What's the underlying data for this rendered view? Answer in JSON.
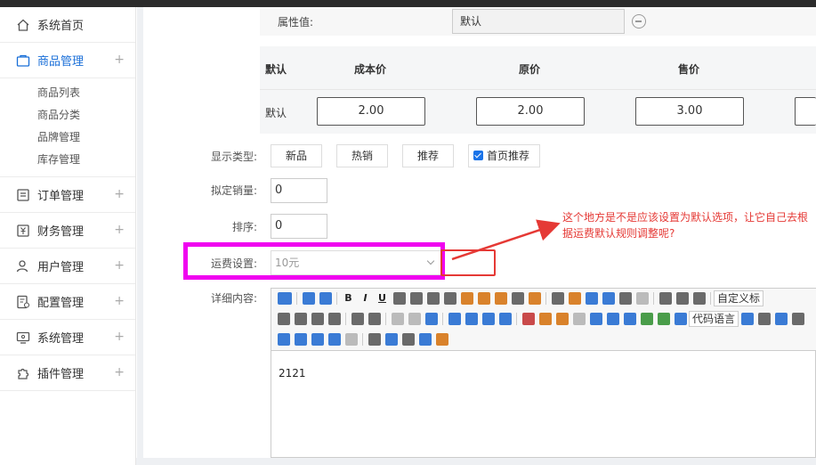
{
  "sidebar": {
    "items": [
      {
        "label": "系统首页",
        "icon": "home-icon"
      },
      {
        "label": "商品管理",
        "icon": "box-icon",
        "active": true
      },
      {
        "label": "订单管理",
        "icon": "order-icon"
      },
      {
        "label": "财务管理",
        "icon": "finance-icon"
      },
      {
        "label": "用户管理",
        "icon": "user-icon"
      },
      {
        "label": "配置管理",
        "icon": "config-icon"
      },
      {
        "label": "系统管理",
        "icon": "monitor-icon"
      },
      {
        "label": "插件管理",
        "icon": "puzzle-icon"
      }
    ],
    "expand_symbol": "+",
    "sub_items": [
      "商品列表",
      "商品分类",
      "品牌管理",
      "库存管理"
    ]
  },
  "attr": {
    "label": "属性值:",
    "value": "默认"
  },
  "price_table": {
    "headers": [
      "默认",
      "成本价",
      "原价",
      "售价"
    ],
    "row_label": "默认",
    "values": [
      "2.00",
      "2.00",
      "3.00"
    ]
  },
  "form": {
    "display_type_label": "显示类型:",
    "tags": [
      "新品",
      "热销",
      "推荐"
    ],
    "home_recommend": "首页推荐",
    "planned_sales_label": "拟定销量:",
    "planned_sales_value": "0",
    "sort_label": "排序:",
    "sort_value": "0",
    "shipping_label": "运费设置:",
    "shipping_value": "10元",
    "detail_label": "详细内容:"
  },
  "annotation": "这个地方是不是应该设置为默认选项，让它自己去根据运费默认规则调整呢?",
  "editor": {
    "custom_title": "自定义标",
    "code_lang": "代码语言",
    "content": "2121"
  },
  "colors": {
    "accent": "#1a6fd8",
    "highlight": "#f000f0",
    "annotation": "#e53935"
  }
}
